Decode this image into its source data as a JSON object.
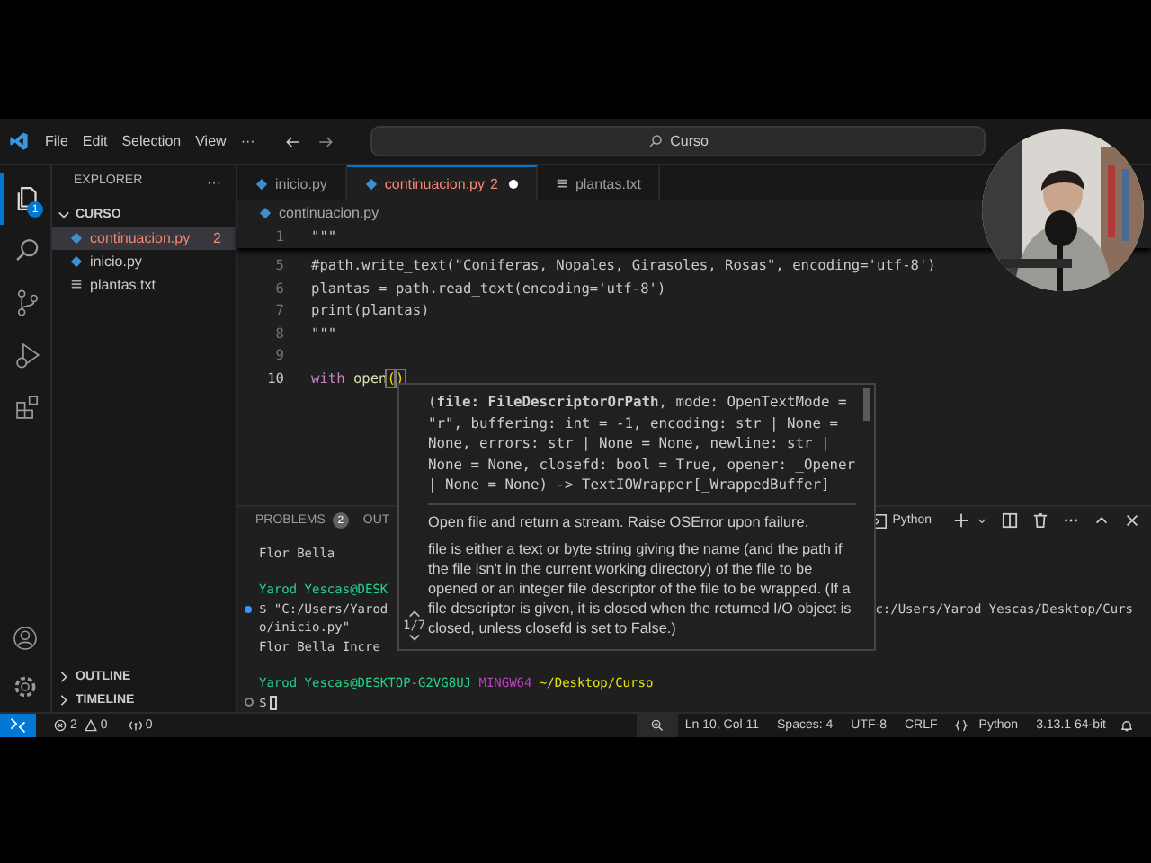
{
  "title_bar": {
    "menu": [
      "File",
      "Edit",
      "Selection",
      "View",
      "···"
    ],
    "command_center": "Curso"
  },
  "activity_bar": {
    "items": [
      {
        "kind": "explorer",
        "selected": true,
        "badge": "1"
      },
      {
        "kind": "search",
        "selected": false
      },
      {
        "kind": "source-control",
        "selected": false
      },
      {
        "kind": "run",
        "selected": false
      },
      {
        "kind": "extensions",
        "selected": false
      }
    ],
    "bottom": [
      {
        "kind": "account"
      },
      {
        "kind": "settings"
      }
    ]
  },
  "sidebar": {
    "title": "EXPLORER",
    "more": "···",
    "folder": "CURSO",
    "files": [
      {
        "name": "continuacion.py",
        "kind": "python",
        "selected": true,
        "problems": "2"
      },
      {
        "name": "inicio.py",
        "kind": "python",
        "selected": false
      },
      {
        "name": "plantas.txt",
        "kind": "text",
        "selected": false
      }
    ],
    "sections": [
      "OUTLINE",
      "TIMELINE"
    ]
  },
  "tabs": [
    {
      "label": "inicio.py",
      "kind": "python",
      "selected": false,
      "modified": false
    },
    {
      "label": "continuacion.py",
      "kind": "python",
      "selected": true,
      "modified": true,
      "problems": "2"
    },
    {
      "label": "plantas.txt",
      "kind": "text",
      "selected": false,
      "modified": false
    }
  ],
  "breadcrumb": "continuacion.py",
  "sticky_line": {
    "number": "1",
    "text": "\"\"\""
  },
  "code_lines": [
    {
      "number": "5",
      "current": false,
      "tokens": [
        {
          "text": "#path.write_text(\"Coniferas, Nopales, Girasoles, Rosas\", encoding='utf-8')",
          "kind": "plain"
        }
      ]
    },
    {
      "number": "6",
      "current": false,
      "tokens": [
        {
          "text": "plantas = path.read_text(encoding='utf-8')",
          "kind": "plain"
        }
      ]
    },
    {
      "number": "7",
      "current": false,
      "tokens": [
        {
          "text": "print(plantas)",
          "kind": "plain"
        }
      ]
    },
    {
      "number": "8",
      "current": false,
      "tokens": [
        {
          "text": "\"\"\"",
          "kind": "plain"
        }
      ]
    },
    {
      "number": "9",
      "current": false
    },
    {
      "number": "10",
      "current": true,
      "tokens": [
        {
          "text": "with",
          "kind": "keyword"
        },
        {
          "text": "open",
          "kind": "function"
        },
        {
          "text": "(",
          "kind": "bracket"
        },
        {
          "text": ")",
          "kind": "bracket"
        }
      ]
    }
  ],
  "hover": {
    "signature": "(**file: FileDescriptorOrPath**, mode: OpenTextMode = \"r\", buffering: int = -1, encoding: str | None = None, errors: str | None = None, newline: str | None = None, closefd: bool = True, opener: _Opener | None = None) -> TextIOWrapper[_WrappedBuffer]",
    "paragraphs": [
      "Open file and return a stream. Raise OSError upon failure.",
      "file is either a text or byte string giving the name (and the path if the file isn't in the current working directory) of the file to be opened or an integer file descriptor of the file to be wrapped. (If a file descriptor is given, it is closed when the returned I/O object is closed, unless closefd is set to False.)"
    ],
    "pager": "1/7"
  },
  "panel": {
    "tabs": [
      {
        "label": "PROBLEMS",
        "badge": "2",
        "selected": false
      },
      {
        "label": "OUT",
        "selected": false
      }
    ],
    "terminal_name": "Python"
  },
  "terminal": {
    "lines": [
      {
        "kind": "output",
        "segments": [
          {
            "text": "Flor Bella",
            "kind": "output"
          }
        ]
      },
      {
        "kind": "blank"
      },
      {
        "kind": "output",
        "segments": [
          {
            "text": "Yarod Yescas@DESK",
            "kind": "user"
          }
        ]
      },
      {
        "kind": "command-success",
        "segments": [
          {
            "text": "$ \"C:/Users/Yarod",
            "kind": "output"
          }
        ],
        "right": "c:/Users/Yarod Yescas/Desktop/Curs"
      },
      {
        "kind": "output",
        "segments": [
          {
            "text": "o/inicio.py\"",
            "kind": "output"
          }
        ]
      },
      {
        "kind": "output",
        "segments": [
          {
            "text": "Flor Bella Incre",
            "kind": "output"
          }
        ]
      },
      {
        "kind": "blank"
      },
      {
        "kind": "output",
        "segments": [
          {
            "text": "Yarod Yescas@DESKTOP-G2VG8UJ",
            "kind": "user"
          },
          {
            "text": " MINGW64",
            "kind": "host"
          },
          {
            "text": " ~/Desktop/Curso",
            "kind": "path"
          }
        ]
      },
      {
        "kind": "prompt",
        "segments": [
          {
            "text": "$",
            "kind": "output"
          }
        ],
        "cursor": true
      }
    ]
  },
  "status_bar": {
    "errors": "2",
    "warnings": "0",
    "ports": "0",
    "right": [
      "Ln 10, Col 11",
      "Spaces: 4",
      "UTF-8",
      "CRLF",
      "Python",
      "3.13.1 64-bit"
    ]
  }
}
